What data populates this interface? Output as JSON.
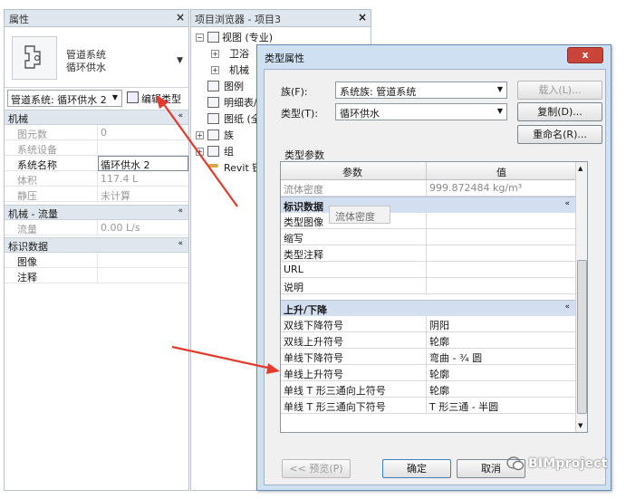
{
  "properties_panel": {
    "title": "属性",
    "close": "×",
    "type_name_line1": "管道系统",
    "type_name_line2": "循环供水",
    "selector_value": "管道系统: 循环供水 2",
    "edit_type_label": "编辑类型",
    "groups": [
      {
        "title": "机械",
        "collapse": "«",
        "rows": [
          {
            "key": "图元数",
            "value": "0"
          },
          {
            "key": "系统设备",
            "value": ""
          },
          {
            "key": "系统名称",
            "value": "循环供水 2"
          },
          {
            "key": "体积",
            "value": "117.4 L"
          },
          {
            "key": "静压",
            "value": "未计算"
          }
        ]
      },
      {
        "title": "机械 - 流量",
        "collapse": "«",
        "rows": [
          {
            "key": "流量",
            "value": "0.00 L/s"
          }
        ]
      },
      {
        "title": "标识数据",
        "collapse": "«",
        "rows": [
          {
            "key": "图像",
            "value": ""
          },
          {
            "key": "注释",
            "value": ""
          }
        ]
      }
    ]
  },
  "project_browser": {
    "title": "项目浏览器 - 项目3",
    "close": "×",
    "nodes": [
      "视图 (专业)",
      "卫浴",
      "机械",
      "图例",
      "明细表/",
      "图纸 (全",
      "族",
      "组",
      "Revit 链"
    ]
  },
  "dialog": {
    "title": "类型属性",
    "close": "x",
    "family_label": "族(F):",
    "family_value": "系统族: 管道系统",
    "type_label": "类型(T):",
    "type_value": "循环供水",
    "load_button": "载入(L)...",
    "duplicate_button": "复制(D)...",
    "rename_button": "重命名(R)...",
    "type_params_label": "类型参数",
    "col_param": "参数",
    "col_value": "值",
    "rows_top": [
      {
        "key": "流体密度",
        "value": "999.872484 kg/m³"
      }
    ],
    "section1": {
      "title": "标识数据",
      "collapse": "«",
      "rows": [
        {
          "key": "类型图像",
          "value": ""
        },
        {
          "key": "缩写",
          "value": ""
        },
        {
          "key": "类型注释",
          "value": ""
        },
        {
          "key": "URL",
          "value": ""
        },
        {
          "key": "说明",
          "value": ""
        }
      ]
    },
    "section2": {
      "title": "上升/下降",
      "collapse": "«",
      "rows": [
        {
          "key": "双线下降符号",
          "value": "阴阳"
        },
        {
          "key": "双线上升符号",
          "value": "轮廓"
        },
        {
          "key": "单线下降符号",
          "value": "弯曲 - ¾ 圆"
        },
        {
          "key": "单线上升符号",
          "value": "轮廓"
        },
        {
          "key": "单线 T 形三通向上符号",
          "value": "轮廓"
        },
        {
          "key": "单线 T 形三通向下符号",
          "value": "T 形三通 - 半圆"
        }
      ]
    },
    "tooltip": "流体密度",
    "preview_button": "<< 预览(P)",
    "ok_button": "确定",
    "cancel_button": "取消"
  },
  "watermark": "BIMproject",
  "colors": {
    "arrow": "#e23b2e",
    "title_bar": "#dfe6ee",
    "dialog_frame": "#cfe0f2"
  }
}
